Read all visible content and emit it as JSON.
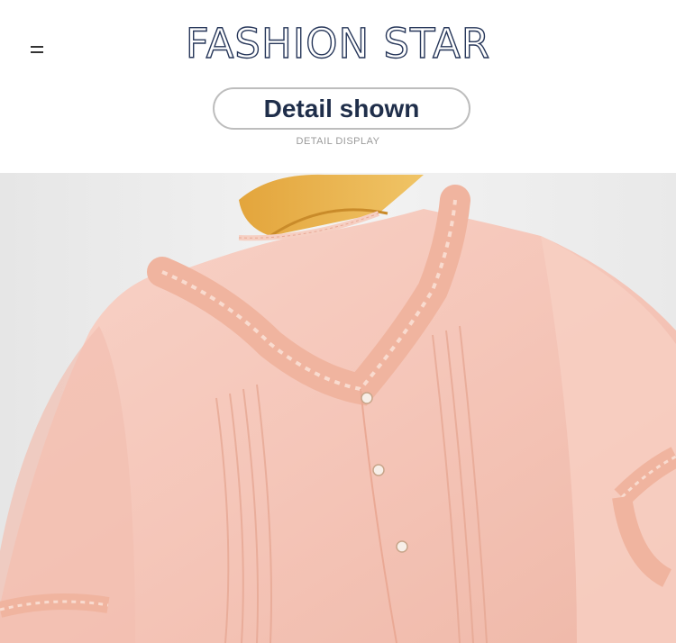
{
  "header": {
    "brand": "FASHION STAR",
    "section_title": "Detail shown",
    "section_caption": "DETAIL DISPLAY"
  },
  "icons": {
    "menu": "menu-icon"
  },
  "colors": {
    "brand_outline": "#27375a",
    "title": "#1f2e4a",
    "caption": "#9a9a9a",
    "fabric": "#f4c3b6",
    "hanger": "#e9b24a"
  }
}
